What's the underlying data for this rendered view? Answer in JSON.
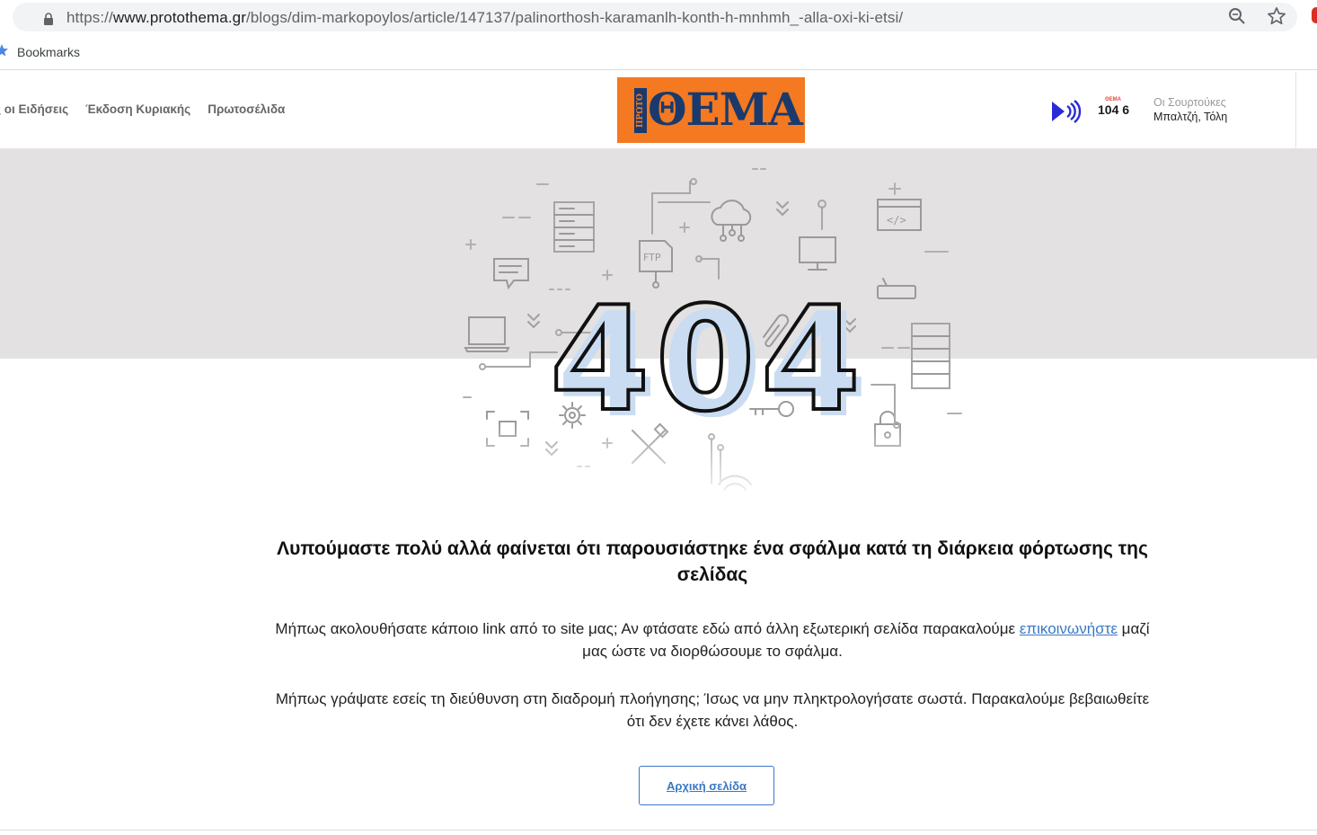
{
  "browser": {
    "url_scheme": "https://",
    "url_host": "www.protothema.gr",
    "url_path": "/blogs/dim-markopoylos/article/147137/palinorthosh-karamanlh-konth-h-mnhmh_-alla-oxi-ki-etsi/",
    "bookmarks_label": "Bookmarks",
    "icons": [
      "lock-icon",
      "zoom-icon",
      "star-icon",
      "bookmark-star-icon"
    ]
  },
  "header": {
    "nav": [
      "ς οι Ειδήσεις",
      "Έκδοση Κυριακής",
      "Πρωτοσέλιδα"
    ],
    "logo": {
      "small": "ΠΡΩΤΟ",
      "big": "ΘΕΜΑ",
      "bg_color": "#f47920",
      "text_color": "#1a3a6e"
    },
    "radio": {
      "freq_main": "104",
      "freq_sub": "6",
      "freq_tag": "ΘΕΜΑ",
      "show_title": "Οι Σουρτούκες",
      "show_hosts": "Μπαλτζή, Τόλη"
    }
  },
  "error": {
    "code": "404",
    "heading": "Λυπούμαστε πολύ αλλά φαίνεται ότι παρουσιάστηκε ένα σφάλμα κατά τη διάρκεια φόρτωσης της σελίδας",
    "para1_before": "Μήπως ακολουθήσατε κάποιο link από το site μας; Αν φτάσατε εδώ από άλλη εξωτερική σελίδα παρακαλούμε ",
    "para1_link": "επικοινωνήστε",
    "para1_after": " μαζί μας ώστε να διορθώσουμε το σφάλμα.",
    "para2": "Μήπως γράψατε εσείς τη διεύθυνση στη διαδρομή πλοήγησης; Ίσως να μην πληκτρολογήσατε σωστά. Παρακαλούμε βεβαιωθείτε ότι δεν έχετε κάνει λάθος.",
    "home_button": "Αρχική σελίδα"
  },
  "colors": {
    "accent": "#3a78c3",
    "band": "#e3e1e2",
    "digit_fill": "#c9dcf2"
  }
}
